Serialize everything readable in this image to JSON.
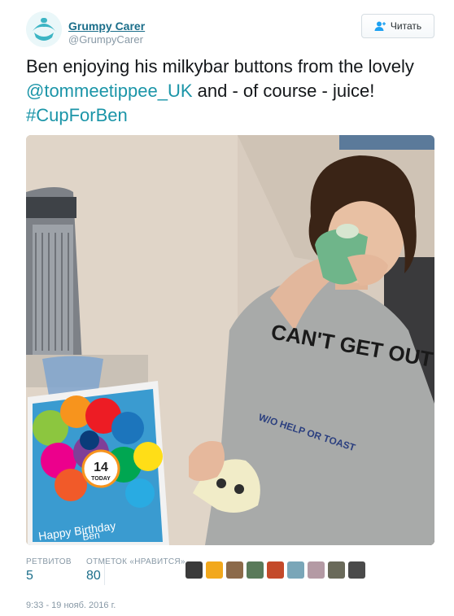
{
  "author": {
    "name": "Grumpy Carer",
    "handle": "@GrumpyCarer",
    "avatar_icon": "baby-bottle-logo-icon"
  },
  "follow_button": {
    "label": "Читать",
    "icon": "add-user-icon"
  },
  "tweet": {
    "text_before": "Ben enjoying his milkybar buttons  from the lovely ",
    "mention": "@tommeetippee_UK",
    "text_middle": " and - of course - juice! ",
    "hashtag": "#CupForBen"
  },
  "photo": {
    "card_number": "14",
    "card_today": "TODAY",
    "card_text": "Happy Birthday",
    "card_name": "Ben",
    "shirt_text": "CAN'T GET OUT OF BED",
    "shirt_subtext": "W/O HELP OR TOAST"
  },
  "stats": {
    "retweets_label": "РЕТВИТОВ",
    "retweets_value": "5",
    "likes_label": "ОТМЕТОК «НРАВИТСЯ»",
    "likes_value": "80"
  },
  "liker_colors": [
    "#3a3a3a",
    "#f2a81c",
    "#8c6a4a",
    "#5a7a5a",
    "#c44a2a",
    "#7aa6b8",
    "#b49aa4",
    "#6a6a5a",
    "#4a4a4a"
  ],
  "timestamp": "9:33 - 19 нояб. 2016 г."
}
